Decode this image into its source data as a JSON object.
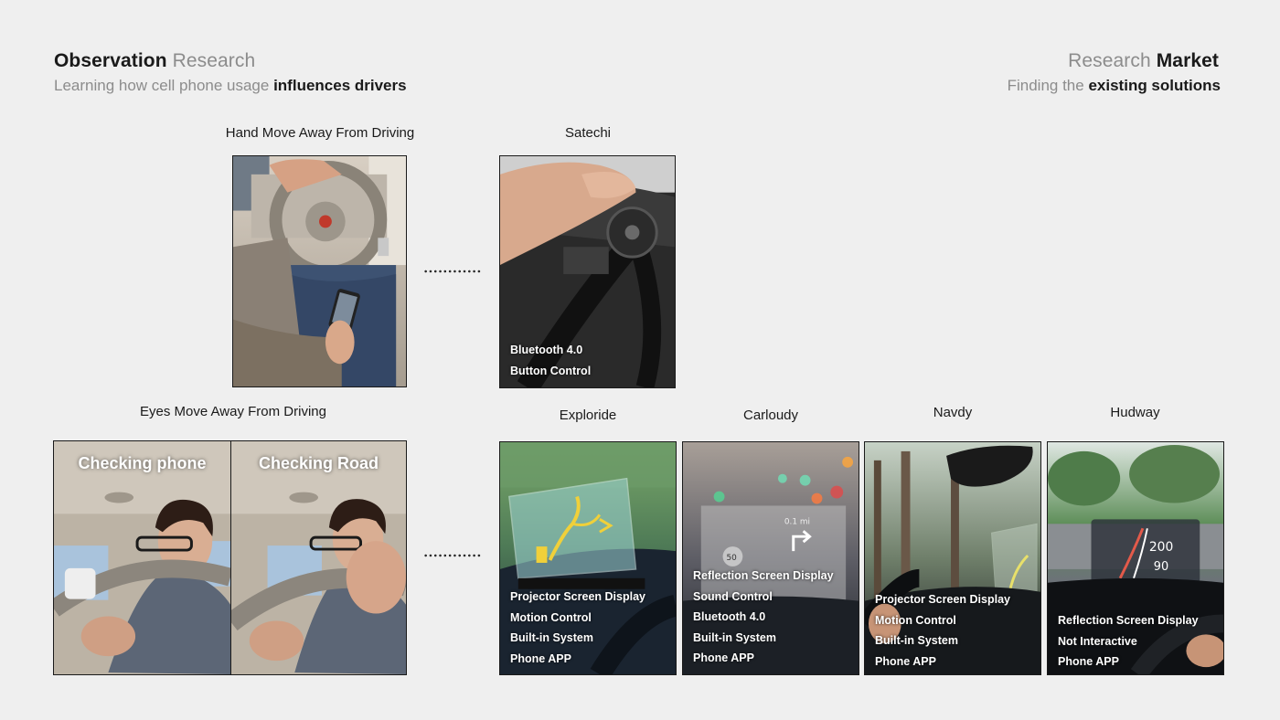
{
  "left_header": {
    "title_bold": "Observation",
    "title_light": "Research",
    "subtitle_light": "Learning how cell phone usage",
    "subtitle_bold": "influences drivers"
  },
  "right_header": {
    "title_light": "Research",
    "title_bold": "Market",
    "subtitle_light": "Finding the",
    "subtitle_bold": "existing solutions"
  },
  "observations": {
    "hand": {
      "label": "Hand Move Away From Driving"
    },
    "eyes": {
      "label": "Eyes Move Away From Driving",
      "left_caption": "Checking phone",
      "right_caption": "Checking Road"
    }
  },
  "products": [
    {
      "name": "Satechi",
      "features": [
        "Bluetooth 4.0",
        "Button Control"
      ]
    },
    {
      "name": "Exploride",
      "features": [
        "Projector Screen Display",
        "Motion Control",
        "Built-in System",
        "Phone APP"
      ]
    },
    {
      "name": "Carloudy",
      "features": [
        "Reflection Screen Display",
        "Sound Control",
        "Bluetooth 4.0",
        "Built-in System",
        "Phone APP"
      ]
    },
    {
      "name": "Navdy",
      "features": [
        "Projector Screen Display",
        "Motion Control",
        "Built-in System",
        "Phone APP"
      ]
    },
    {
      "name": "Hudway",
      "features": [
        "Reflection Screen Display",
        "Not Interactive",
        "Phone APP"
      ]
    }
  ],
  "hud_readouts": {
    "carloudy_distance": "0.1 mi",
    "carloudy_speed": "50",
    "hudway_top": "200",
    "hudway_bottom": "90"
  },
  "colors": {
    "background": "#efefef",
    "text_dark": "#1a1a1a",
    "text_light": "#8c8c8c"
  }
}
